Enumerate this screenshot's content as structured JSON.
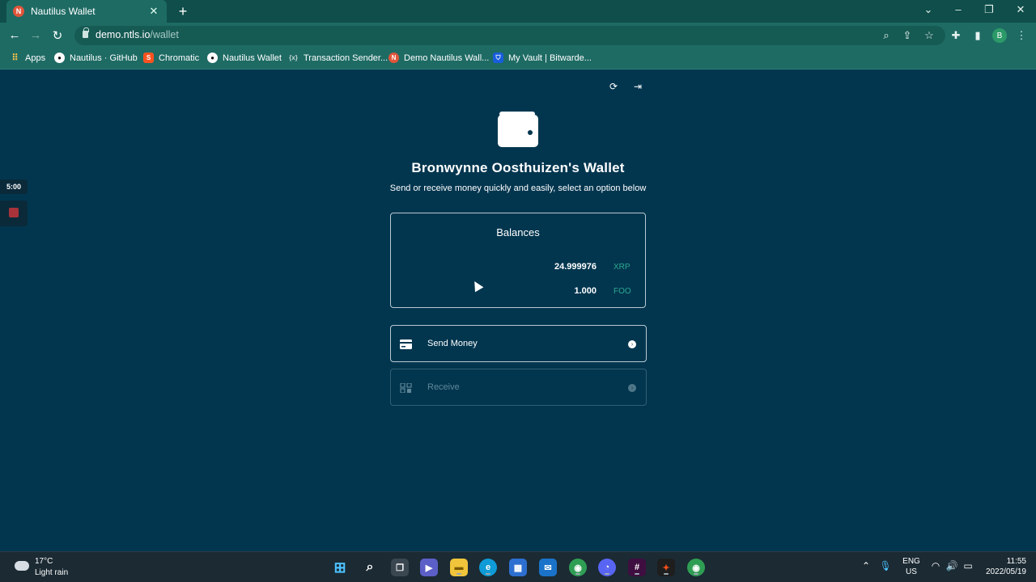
{
  "browser": {
    "tab_title": "Nautilus Wallet",
    "tab_favicon_letter": "N",
    "url_host": "demo.ntls.io",
    "url_path": "/wallet",
    "profile_initial": "B",
    "bookmarks": [
      {
        "label": "Apps",
        "icon": "apps-grid-icon"
      },
      {
        "label": "Nautilus · GitHub",
        "icon": "github-icon"
      },
      {
        "label": "Chromatic",
        "icon": "chromatic-icon"
      },
      {
        "label": "Nautilus Wallet",
        "icon": "github-icon"
      },
      {
        "label": "Transaction Sender...",
        "icon": "transaction-icon"
      },
      {
        "label": "Demo Nautilus Wall...",
        "icon": "nautilus-icon"
      },
      {
        "label": "My Vault | Bitwarde...",
        "icon": "bitwarden-icon"
      }
    ]
  },
  "wallet": {
    "title": "Bronwynne Oosthuizen's Wallet",
    "subtitle": "Send or receive money quickly and easily, select an option below",
    "balances_heading": "Balances",
    "balances": [
      {
        "amount": "24.999976",
        "currency": "XRP"
      },
      {
        "amount": "1.000",
        "currency": "FOO"
      }
    ],
    "send_label": "Send Money",
    "receive_label": "Receive"
  },
  "recorder": {
    "timer": "5:00"
  },
  "taskbar": {
    "temperature": "17°C",
    "weather": "Light rain",
    "lang_line1": "ENG",
    "lang_line2": "US",
    "time": "11:55",
    "date": "2022/05/19"
  },
  "colors": {
    "page_background": "#02364f",
    "browser_frame": "#1e6b64",
    "currency_accent": "#2ea88f"
  }
}
